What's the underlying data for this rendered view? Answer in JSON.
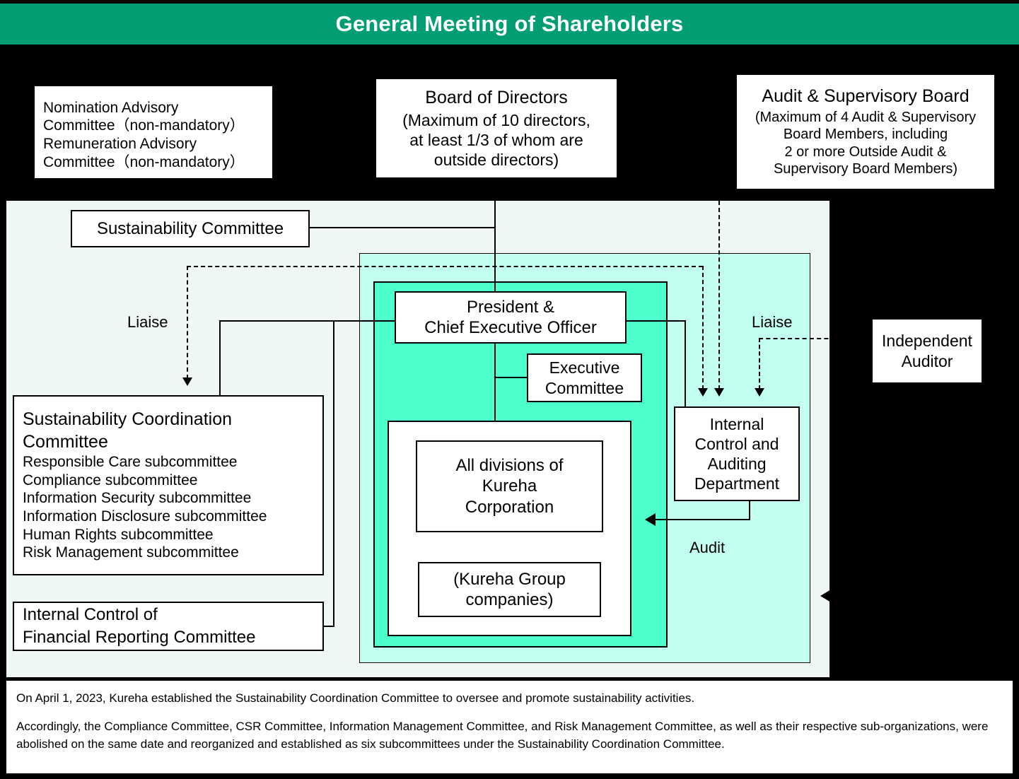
{
  "banner": {
    "title": "General Meeting of Shareholders"
  },
  "top_boxes": {
    "nomination": {
      "lines": [
        "Nomination Advisory",
        "Committee（non-mandatory）",
        "Remuneration Advisory",
        "Committee（non-mandatory）"
      ]
    },
    "board_of_directors": {
      "heading": "Board of Directors",
      "lines": [
        "(Maximum of 10 directors,",
        "at least 1/3 of whom are",
        "outside directors)"
      ]
    },
    "audit_supervisory_board": {
      "heading": "Audit & Supervisory Board",
      "lines": [
        "(Maximum of 4 Audit & Supervisory",
        "Board Members, including",
        "2 or more Outside Audit &",
        "Supervisory Board Members)"
      ]
    }
  },
  "panel": {
    "sustainability_committee": {
      "label": "Sustainability Committee"
    },
    "sustainability_coordination": {
      "heading_lines": [
        "Sustainability Coordination",
        "Committee"
      ],
      "subcommittees": [
        "Responsible Care subcommittee",
        "Compliance subcommittee",
        "Information Security subcommittee",
        "Information Disclosure subcommittee",
        "Human Rights subcommittee",
        "Risk Management subcommittee"
      ]
    },
    "internal_control_financial_reporting": {
      "lines": [
        "Internal Control of",
        "Financial Reporting Committee"
      ]
    },
    "president": {
      "lines": [
        "President &",
        "Chief Executive Officer"
      ]
    },
    "executive_committee": {
      "lines": [
        "Executive",
        "Committee"
      ]
    },
    "all_divisions": {
      "lines": [
        "All divisions of",
        "Kureha",
        "Corporation"
      ]
    },
    "group_companies": {
      "lines": [
        "(Kureha Group",
        "companies)"
      ]
    },
    "internal_control_auditing": {
      "lines": [
        "Internal",
        "Control and",
        "Auditing",
        "Department"
      ]
    },
    "independent_auditor": {
      "lines": [
        "Independent",
        "Auditor"
      ]
    },
    "labels": {
      "liaise_left": "Liaise",
      "liaise_right": "Liaise",
      "audit": "Audit"
    }
  },
  "note": {
    "paragraph1": "On April 1, 2023, Kureha established the Sustainability Coordination Committee to oversee and promote sustainability activities.",
    "paragraph2": "Accordingly, the Compliance Committee, CSR Committee, Information Management Committee, and Risk Management Committee, as well as their respective sub-organizations, were abolished on the same date and reorganized and established as six subcommittees under the Sustainability Coordination Committee."
  },
  "colors": {
    "banner_green": "#009E72",
    "panel_outer": "#EFF7F3",
    "panel_mid": "#C2FFF0",
    "panel_inner": "#4DFFCC",
    "line": "#000000",
    "box_fill": "#FFFFFF"
  }
}
